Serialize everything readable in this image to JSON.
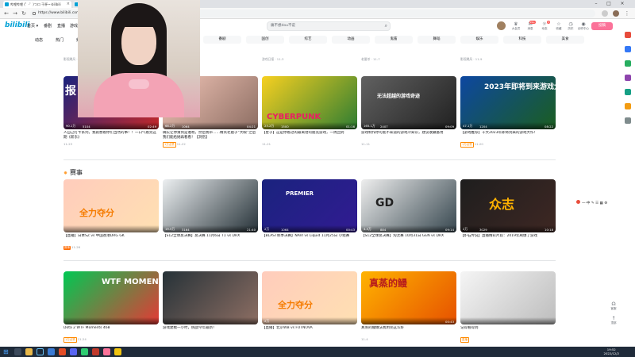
{
  "browser": {
    "tabs": [
      {
        "label": "哔哩哔哩 (゜-゜)つロ 干杯~-bilibili"
      },
      {
        "label": "哔哩哔哩 (゜-゜)つロ 干杯~-bilibili"
      }
    ],
    "url": "https://www.bilibili.com"
  },
  "header": {
    "logo": "bilibili",
    "nav": [
      "首页 ▾",
      "番剧",
      "直播",
      "游戏中心"
    ],
    "search_placeholder": "痛不想dou不说",
    "icons": [
      {
        "label": "大会员",
        "icon": "crown-icon"
      },
      {
        "label": "消息",
        "icon": "message-icon",
        "badge": "99+"
      },
      {
        "label": "动态",
        "icon": "wind-icon",
        "badge": "3"
      },
      {
        "label": "收藏",
        "icon": "star-icon"
      },
      {
        "label": "历史",
        "icon": "clock-icon"
      },
      {
        "label": "创作中心",
        "icon": "bulb-icon"
      }
    ],
    "upload": "投稿"
  },
  "subnav": {
    "quick": [
      "动态",
      "热门",
      "频道"
    ],
    "pills": [
      "番剧",
      "国创",
      "综艺",
      "动画",
      "鬼畜",
      "舞蹈",
      "娱乐",
      "科技",
      "美食",
      "汽车",
      "运动",
      "VLOG",
      "番剧漫画",
      "公益",
      "专栏",
      "直播",
      "活动",
      "社区中心"
    ]
  },
  "row0": [
    {
      "meta": "影视飓风 · 12-2"
    },
    {
      "meta": "王者荣耀 · 10-13"
    },
    {
      "meta": "游戏日报 · 11-3"
    },
    {
      "meta": "老番茶 · 11-7"
    },
    {
      "meta": "影视飓风 · 11-9"
    }
  ],
  "row1": [
    {
      "title": "人自己打卡系列，我就想看你们当然的事！！一口气看完这期《新东》",
      "meta": "11-23",
      "views": "90.1万",
      "danmaku": "5104",
      "duration": "02:49",
      "text": "报"
    },
    {
      "title": "确实让你猜到是谁啦，然后我带……精英老鹿子“大眼”之后我们能给她再看看！【洞伤】",
      "meta": "11-22",
      "tag": "1万点赞",
      "views": "68.2万",
      "danmaku": "1064",
      "duration": "04:21",
      "text": ""
    },
    {
      "title": "【星子】这是你看过的最离谱的朋克游戏，一周回到",
      "meta": "11-21",
      "views": "23.2万",
      "danmaku": "1500",
      "duration": "01:16",
      "text": "CYBERPUNK"
    },
    {
      "title": "游戏制作你可能不知道的游戏冷知识，建议收藏备用",
      "meta": "11-11",
      "views": "165.1万",
      "danmaku": "2407",
      "duration": "09:09",
      "text": "无法超越的游戏奇迹"
    },
    {
      "title": "【游戏推荐】十大2023年即将到来的游戏大作！",
      "meta": "11-20",
      "tag": "1万点赞",
      "views": "47.1万",
      "danmaku": "1204",
      "duration": "08:22",
      "text": "2023年即将到来游戏大作"
    }
  ],
  "section_title": "赛事",
  "row2": [
    {
      "title": "【直播】日本SZ vs 中国香港DRG GK",
      "meta": "11-26",
      "tag": "赛事",
      "views": "",
      "danmaku": "",
      "duration": "",
      "text": "全力夺分"
    },
    {
      "title": "【S12全球总决赛】总决赛 11月6日 T1 vs DRX",
      "meta": "",
      "views": "19.5万",
      "danmaku": "3164",
      "duration": "21:40",
      "text": ""
    },
    {
      "title": "【BLAST秋季决赛】NAVI vs Liquid 11月25日 小组赛",
      "meta": "",
      "views": "2万",
      "danmaku": "1064",
      "duration": "00:43",
      "text": "PREMIER"
    },
    {
      "title": "【S12全球总决赛】淘汰赛 10月31日 GEN vs DRX",
      "meta": "",
      "views": "4.5万",
      "danmaku": "884",
      "duration": "09:14",
      "text": "GD"
    },
    {
      "title": "【炉石传说】直播精彩片段：2019年刷爆了游戏",
      "meta": "",
      "views": "2万",
      "danmaku": "3029",
      "duration": "10:18",
      "text": "众志"
    }
  ],
  "row3": [
    {
      "title": "Dota 2 WTF Moments 468",
      "meta": "11-24",
      "tag": "1万点赞",
      "views": "",
      "danmaku": "",
      "duration": "",
      "text": "WTF MOMENTS 468"
    },
    {
      "title": "游戏建模一小时，挑战今年最新！",
      "meta": "",
      "views": "",
      "danmaku": "",
      "duration": "",
      "text": ""
    },
    {
      "title": "【直播】北京WB vs FUTNOVA",
      "meta": "",
      "views": "2万",
      "danmaku": "",
      "duration": "",
      "text": "全力夺分"
    },
    {
      "title": "真蒸的鳗做法我用完这么好",
      "meta": "11-4",
      "views": "",
      "danmaku": "",
      "duration": "00:43",
      "text": "真蒸的鳗"
    },
    {
      "title": "记得看得到",
      "meta": "",
      "tag": "直播",
      "views": "",
      "danmaku": "",
      "duration": "",
      "text": ""
    }
  ],
  "side_toolbar": "一·中 ✎ ☰ ▦ ⚙",
  "float": [
    {
      "label": "客服"
    },
    {
      "label": "顶部"
    }
  ],
  "taskbar": {
    "time": "19:52",
    "date": "2022/12/2"
  }
}
